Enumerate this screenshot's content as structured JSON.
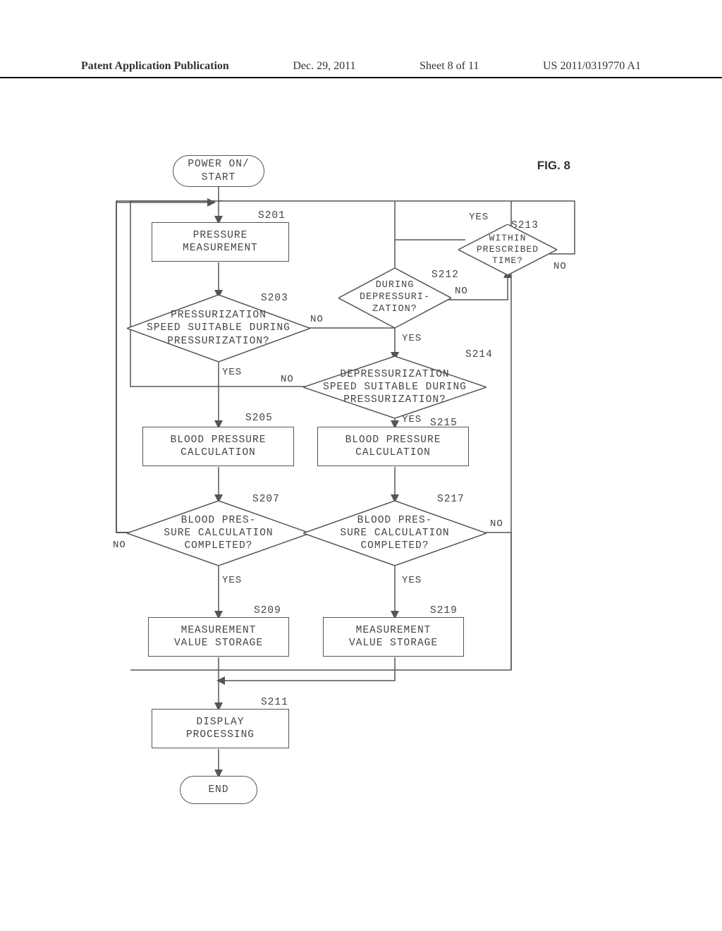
{
  "header": {
    "left": "Patent Application Publication",
    "date": "Dec. 29, 2011",
    "sheet": "Sheet 8 of 11",
    "pub_no": "US 2011/0319770 A1"
  },
  "figure_label": "FIG. 8",
  "steps": {
    "start": "POWER ON/\nSTART",
    "s201_label": "S201",
    "s201": "PRESSURE\nMEASUREMENT",
    "s203_label": "S203",
    "s203": "PRESSURIZATION\nSPEED SUITABLE DURING\nPRESSURIZATION?",
    "s205_label": "S205",
    "s205": "BLOOD PRESSURE\nCALCULATION",
    "s207_label": "S207",
    "s207": "BLOOD PRES-\nSURE CALCULATION\nCOMPLETED?",
    "s209_label": "S209",
    "s209": "MEASUREMENT\nVALUE STORAGE",
    "s211_label": "S211",
    "s211": "DISPLAY\nPROCESSING",
    "end": "END",
    "s212_label": "S212",
    "s212": "DURING\nDEPRESSURI-\nZATION?",
    "s213_label": "S213",
    "s213": "WITHIN\nPRESCRIBED\nTIME?",
    "s214_label": "S214",
    "s214": "DEPRESSURIZATION\nSPEED SUITABLE DURING\nPRESSURIZATION?",
    "s215_label": "S215",
    "s215": "BLOOD PRESSURE\nCALCULATION",
    "s217_label": "S217",
    "s217": "BLOOD PRES-\nSURE CALCULATION\nCOMPLETED?",
    "s219_label": "S219",
    "s219": "MEASUREMENT\nVALUE STORAGE"
  },
  "branches": {
    "yes": "YES",
    "no": "NO"
  }
}
